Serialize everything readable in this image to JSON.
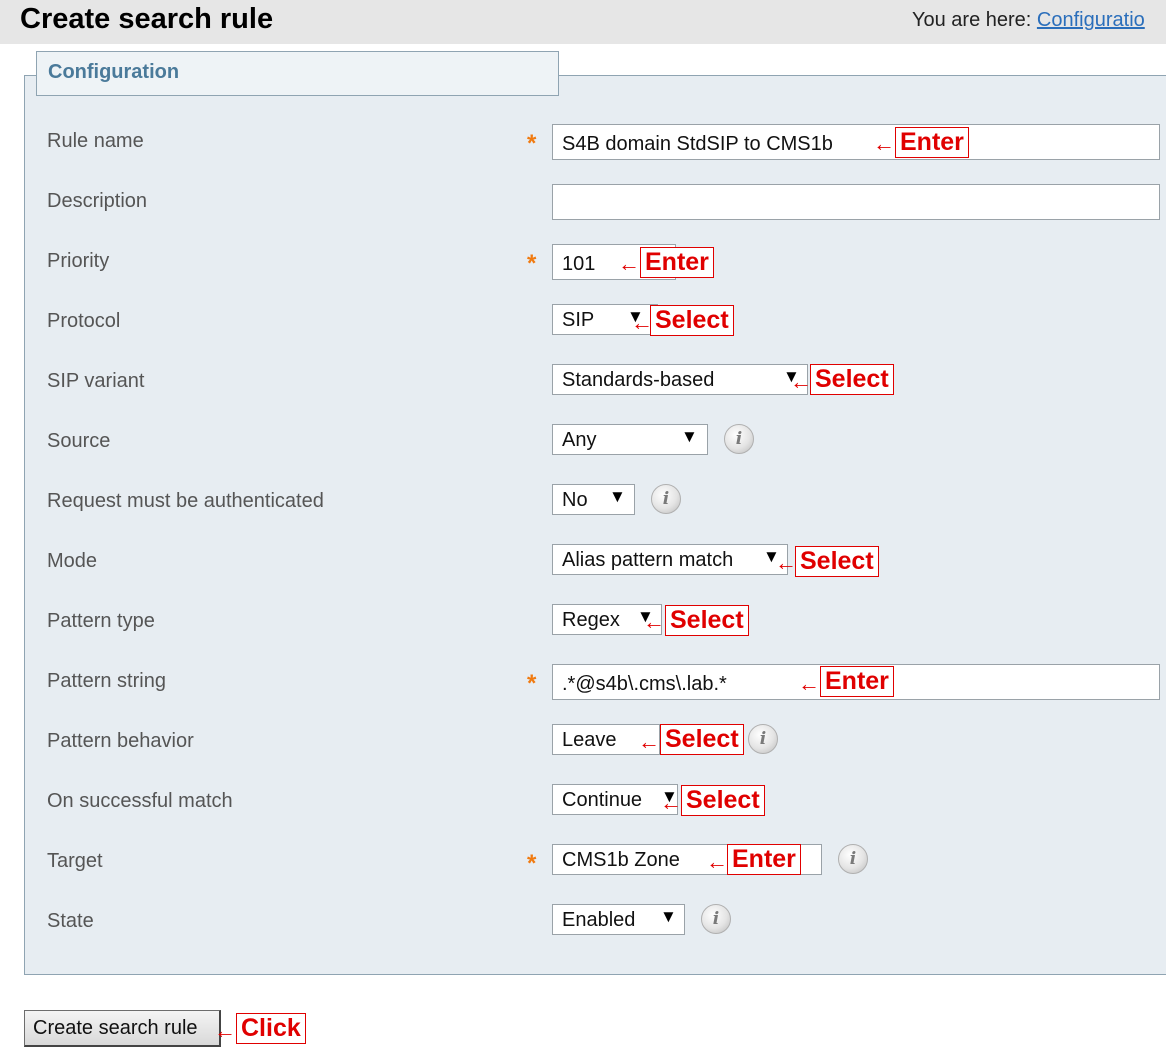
{
  "header": {
    "title": "Create search rule",
    "breadcrumb_prefix": "You are here:",
    "breadcrumb_link": "Configuratio"
  },
  "panel": {
    "title": "Configuration"
  },
  "required_marker": "*",
  "fields": {
    "rule_name": {
      "label": "Rule name",
      "value": "S4B domain StdSIP to CMS1b",
      "note": "Enter"
    },
    "description": {
      "label": "Description",
      "value": ""
    },
    "priority": {
      "label": "Priority",
      "value": "101",
      "note": "Enter"
    },
    "protocol": {
      "label": "Protocol",
      "value": "SIP",
      "note": "Select"
    },
    "sip_variant": {
      "label": "SIP variant",
      "value": "Standards-based",
      "note": "Select"
    },
    "source": {
      "label": "Source",
      "value": "Any"
    },
    "request_auth": {
      "label": "Request must be authenticated",
      "value": "No"
    },
    "mode": {
      "label": "Mode",
      "value": "Alias pattern match",
      "note": "Select"
    },
    "pattern_type": {
      "label": "Pattern type",
      "value": "Regex",
      "note": "Select"
    },
    "pattern_string": {
      "label": "Pattern string",
      "value": ".*@s4b\\.cms\\.lab.*",
      "note": "Enter"
    },
    "pattern_behavior": {
      "label": "Pattern behavior",
      "value": "Leave",
      "note": "Select"
    },
    "on_match": {
      "label": "On successful match",
      "value": "Continue",
      "note": "Select"
    },
    "target": {
      "label": "Target",
      "value": "CMS1b Zone",
      "note": "Enter"
    },
    "state": {
      "label": "State",
      "value": "Enabled"
    }
  },
  "submit": {
    "label": "Create search rule",
    "note": "Click"
  },
  "glyphs": {
    "dropdown": "▼",
    "info": "i",
    "note_arrow": "←"
  },
  "colors": {
    "note": "#e00000",
    "required": "#f07a10",
    "panel_bg": "#e7edf2",
    "link": "#2a6ebb"
  }
}
